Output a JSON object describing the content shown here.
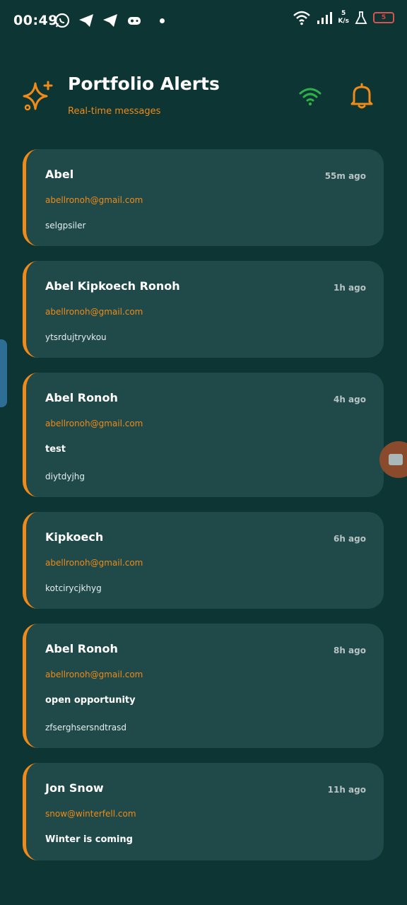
{
  "status_bar": {
    "time": "00:49",
    "speed_value": "5",
    "speed_unit": "K/s",
    "battery": "5"
  },
  "header": {
    "title": "Portfolio Alerts",
    "subtitle": "Real-time messages"
  },
  "colors": {
    "accent": "#f08a18",
    "background": "#0c3534",
    "card": "#1f4a49",
    "wifi": "#2fb14a"
  },
  "alerts": [
    {
      "name": "Abel",
      "time": "55m ago",
      "email": "abellronoh@gmail.com",
      "subject": "",
      "body": "selgpsiler"
    },
    {
      "name": "Abel Kipkoech Ronoh",
      "time": "1h ago",
      "email": "abellronoh@gmail.com",
      "subject": "",
      "body": "ytsrdujtryvkou"
    },
    {
      "name": "Abel Ronoh",
      "time": "4h ago",
      "email": "abellronoh@gmail.com",
      "subject": "test",
      "body": "diytdyjhg"
    },
    {
      "name": "Kipkoech",
      "time": "6h ago",
      "email": "abellronoh@gmail.com",
      "subject": "",
      "body": "kotcirycjkhyg"
    },
    {
      "name": "Abel Ronoh",
      "time": "8h ago",
      "email": "abellronoh@gmail.com",
      "subject": "open opportunity",
      "body": "zfserghsersndtrasd"
    },
    {
      "name": "Jon Snow",
      "time": "11h ago",
      "email": "snow@winterfell.com",
      "subject": "Winter is coming",
      "body": ""
    }
  ]
}
